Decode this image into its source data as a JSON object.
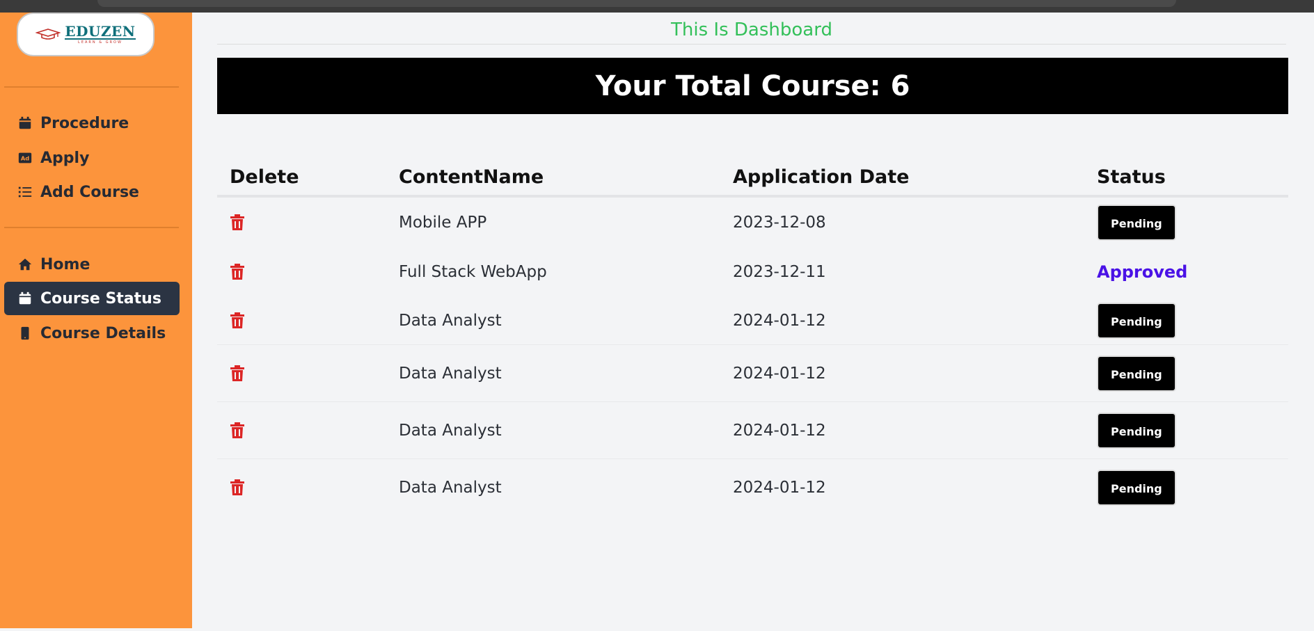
{
  "brand": {
    "logo_name": "EDUZEN",
    "logo_tagline": "LEARN & GROW"
  },
  "sidebar": {
    "group1": [
      {
        "label": "Procedure",
        "icon": "calendar-icon"
      },
      {
        "label": "Apply",
        "icon": "ad-icon"
      },
      {
        "label": "Add Course",
        "icon": "list-icon"
      }
    ],
    "group2": [
      {
        "label": "Home",
        "icon": "home-icon"
      },
      {
        "label": "Course Status",
        "icon": "calendar-icon",
        "active": true
      },
      {
        "label": "Course Details",
        "icon": "mobile-icon"
      }
    ]
  },
  "main": {
    "title": "This Is Dashboard",
    "banner": "Your Total Course: 6"
  },
  "table": {
    "headers": [
      "Delete",
      "ContentName",
      "Application Date",
      "Status"
    ],
    "rows": [
      {
        "name": "Mobile APP",
        "date": "2023-12-08",
        "status": "Pending"
      },
      {
        "name": "Full Stack WebApp",
        "date": "2023-12-11",
        "status": "Approved"
      },
      {
        "name": "Data Analyst",
        "date": "2024-01-12",
        "status": "Pending"
      },
      {
        "name": "Data Analyst",
        "date": "2024-01-12",
        "status": "Pending"
      },
      {
        "name": "Data Analyst",
        "date": "2024-01-12",
        "status": "Pending"
      },
      {
        "name": "Data Analyst",
        "date": "2024-01-12",
        "status": "Pending"
      }
    ]
  },
  "colors": {
    "sidebar_bg": "#fc943c",
    "active_item_bg": "#2b3443",
    "title_green": "#34c05a",
    "trash_red": "#dc2626",
    "approved_purple": "#4a12e6"
  }
}
